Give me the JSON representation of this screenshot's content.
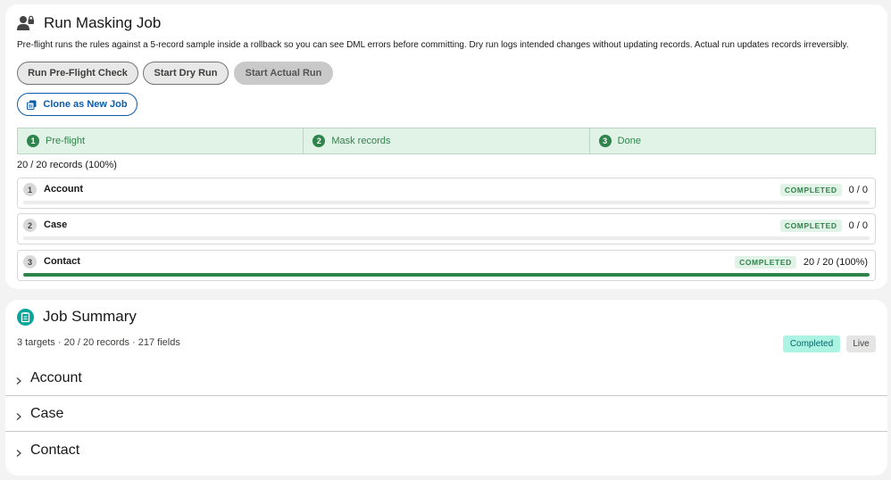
{
  "masking_job": {
    "title": "Run Masking Job",
    "description": "Pre-flight runs the rules against a 5-record sample inside a rollback so you can see DML errors before committing. Dry run logs intended changes without updating records. Actual run updates records irreversibly.",
    "buttons": {
      "preflight": "Run Pre-Flight Check",
      "dry_run": "Start Dry Run",
      "actual_run": "Start Actual Run",
      "clone": "Clone as New Job"
    },
    "steps": [
      {
        "num": "1",
        "label": "Pre-flight"
      },
      {
        "num": "2",
        "label": "Mask records"
      },
      {
        "num": "3",
        "label": "Done"
      }
    ],
    "overall_progress": "20 / 20 records (100%)",
    "objects": [
      {
        "num": "1",
        "name": "Account",
        "status": "COMPLETED",
        "count": "0 / 0",
        "progress": 0
      },
      {
        "num": "2",
        "name": "Case",
        "status": "COMPLETED",
        "count": "0 / 0",
        "progress": 0
      },
      {
        "num": "3",
        "name": "Contact",
        "status": "COMPLETED",
        "count": "20 / 20 (100%)",
        "progress": 1
      }
    ]
  },
  "job_summary": {
    "title": "Job Summary",
    "summary_line": "3 targets · 20 / 20 records · 217 fields",
    "status_badge": "Completed",
    "mode_badge": "Live",
    "sections": [
      {
        "label": "Account"
      },
      {
        "label": "Case"
      },
      {
        "label": "Contact"
      }
    ]
  },
  "colors": {
    "success": "#2e844a",
    "brand": "#0b5cab",
    "teal": "#06a59a"
  },
  "icons": [
    "user-lock-icon",
    "clone-icon",
    "report-icon",
    "chevron-right-icon"
  ]
}
